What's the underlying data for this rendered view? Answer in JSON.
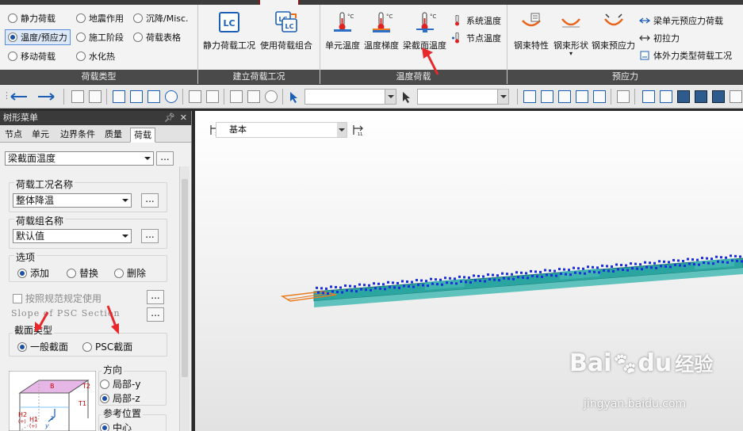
{
  "ribbon": {
    "load_type_group": {
      "title": "荷载类型",
      "radios": [
        {
          "label": "静力荷载",
          "checked": false
        },
        {
          "label": "地震作用",
          "checked": false
        },
        {
          "label": "沉降/Misc.",
          "checked": false
        },
        {
          "label": "温度/预应力",
          "checked": true
        },
        {
          "label": "施工阶段",
          "checked": false
        },
        {
          "label": "荷载表格",
          "checked": false
        },
        {
          "label": "移动荷载",
          "checked": false
        },
        {
          "label": "水化热",
          "checked": false
        }
      ]
    },
    "case_group": {
      "title": "建立荷载工况",
      "buttons": [
        {
          "label": "静力荷载工况",
          "icon": "lc-icon"
        },
        {
          "label": "使用荷载组合",
          "icon": "lc-combo-icon"
        }
      ]
    },
    "temperature_group": {
      "title": "温度荷载",
      "buttons": [
        {
          "label": "单元温度",
          "icon": "element-temperature-icon"
        },
        {
          "label": "温度梯度",
          "icon": "temperature-gradient-icon"
        },
        {
          "label": "梁截面温度",
          "icon": "beam-section-temperature-icon"
        }
      ],
      "small_buttons": [
        {
          "label": "系统温度",
          "icon": "thermometer-icon"
        },
        {
          "label": "节点温度",
          "icon": "node-temperature-icon"
        }
      ]
    },
    "prestress_group": {
      "title": "预应力",
      "buttons": [
        {
          "label": "钢束特性",
          "icon": "tendon-property-icon"
        },
        {
          "label": "钢束形状",
          "icon": "tendon-profile-icon"
        },
        {
          "label": "钢束预应力",
          "icon": "tendon-prestress-icon"
        }
      ],
      "small_buttons": [
        {
          "label": "梁单元预应力荷载",
          "icon": "beam-prestress-icon"
        },
        {
          "label": "初拉力",
          "icon": "pretension-icon"
        },
        {
          "label": "体外力类型荷载工况",
          "icon": "external-force-icon"
        }
      ]
    }
  },
  "panel": {
    "title": "树形菜单",
    "tabs": [
      "节点",
      "单元",
      "边界条件",
      "质量",
      "荷载"
    ],
    "active_tab": "荷载",
    "command_select": "梁截面温度",
    "load_case": {
      "label": "荷载工况名称",
      "value": "整体降温"
    },
    "load_group": {
      "label": "荷载组名称",
      "value": "默认值"
    },
    "options": {
      "label": "选项",
      "items": [
        {
          "label": "添加",
          "checked": true
        },
        {
          "label": "替换",
          "checked": false
        },
        {
          "label": "删除",
          "checked": false
        }
      ]
    },
    "code_checkbox": "按照规范规定使用",
    "slope_label": "Slope of PSC Section",
    "section_type": {
      "label": "截面类型",
      "items": [
        {
          "label": "一般截面",
          "checked": true
        },
        {
          "label": "PSC截面",
          "checked": false
        }
      ]
    },
    "direction": {
      "label": "方向",
      "items": [
        {
          "label": "局部-y",
          "checked": false
        },
        {
          "label": "局部-z",
          "checked": true
        }
      ]
    },
    "reference": {
      "label": "参考位置",
      "items": [
        {
          "label": "中心",
          "checked": true
        }
      ]
    },
    "diagram_labels": {
      "b": "B",
      "t2": "T2",
      "t1": "T1",
      "h2": "H2",
      "h1": "H1",
      "z": "z",
      "y": "y",
      "plus": "(+)"
    }
  },
  "viewport": {
    "view_select": "基本"
  },
  "watermark": {
    "brand": "Bai",
    "paw": "du",
    "cn": "经验",
    "url": "jingyan.baidu.com"
  },
  "colors": {
    "accent_blue": "#1b4fa8",
    "arrow_red": "#e8282b",
    "panel_dark": "#3a3a3a",
    "model_cyan": "#2aa5a0",
    "model_blue": "#1a2ee0"
  }
}
